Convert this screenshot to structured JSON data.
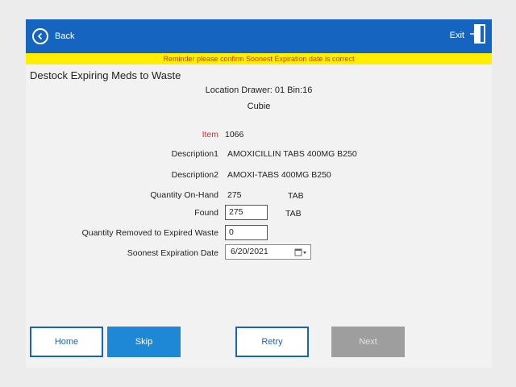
{
  "header": {
    "back_label": "Back",
    "exit_label": "Exit",
    "color": "#1565c0"
  },
  "reminder": "Reminder please confirm Soonest Expiration date is correct",
  "page_title": "Destock Expiring Meds to Waste",
  "location": "Location Drawer: 01 Bin:16",
  "cubie": "Cubie",
  "fields": {
    "item_label": "Item",
    "item_value": "1066",
    "desc1_label": "Description1",
    "desc1_value": "AMOXICILLIN TABS 400MG B250",
    "desc2_label": "Description2",
    "desc2_value": "AMOXI-TABS 400MG B250",
    "qoh_label": "Quantity On-Hand",
    "qoh_value": "275",
    "qoh_unit": "TAB",
    "found_label": "Found",
    "found_value": "275",
    "found_unit": "TAB",
    "removed_label": "Quantity Removed to Expired Waste",
    "removed_value": "0",
    "expiry_label": "Soonest Expiration Date",
    "expiry_value": "6/20/2021"
  },
  "buttons": {
    "home": "Home",
    "skip": "Skip",
    "retry": "Retry",
    "next": "Next"
  },
  "colors": {
    "accent": "#1565c0",
    "reminder_bg": "#ffee00",
    "reminder_text": "#d32f2f",
    "item_label": "#d32f2f"
  },
  "icons": {
    "back": "chevron-left-circle-icon",
    "exit": "exit-door-icon",
    "calendar": "calendar-dropdown-icon"
  }
}
